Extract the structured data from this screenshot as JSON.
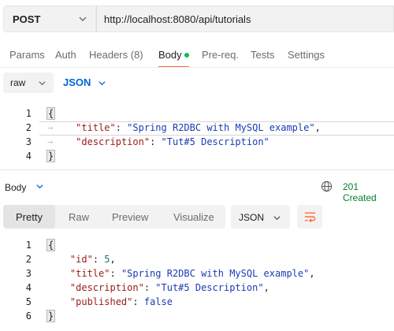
{
  "request": {
    "method": "POST",
    "url": "http://localhost:8080/api/tutorials"
  },
  "request_tabs": [
    {
      "label": "Params",
      "active": false
    },
    {
      "label": "Auth",
      "active": false
    },
    {
      "label": "Headers (8)",
      "active": false
    },
    {
      "label": "Body",
      "active": true
    },
    {
      "label": "Pre-req.",
      "active": false
    },
    {
      "label": "Tests",
      "active": false
    },
    {
      "label": "Settings",
      "active": false
    }
  ],
  "body_mode": {
    "type": "raw",
    "format": "JSON"
  },
  "request_body": {
    "line_numbers": [
      "1",
      "2",
      "3",
      "4"
    ],
    "open_brace": "{",
    "close_brace": "}",
    "fields": [
      {
        "key": "\"title\"",
        "value": "\"Spring R2DBC with MySQL example\"",
        "trail": ","
      },
      {
        "key": "\"description\"",
        "value": "\"Tut#5 Description\"",
        "trail": ""
      }
    ]
  },
  "response": {
    "section_label": "Body",
    "status": "201 Created",
    "status_color": "#007f31",
    "view_tabs": [
      {
        "label": "Pretty",
        "active": true
      },
      {
        "label": "Raw",
        "active": false
      },
      {
        "label": "Preview",
        "active": false
      },
      {
        "label": "Visualize",
        "active": false
      }
    ],
    "format": "JSON",
    "line_numbers": [
      "1",
      "2",
      "3",
      "4",
      "5",
      "6"
    ],
    "open_brace": "{",
    "close_brace": "}",
    "fields": [
      {
        "key": "\"id\"",
        "value": "5",
        "type": "number",
        "trail": ","
      },
      {
        "key": "\"title\"",
        "value": "\"Spring R2DBC with MySQL example\"",
        "type": "string",
        "trail": ","
      },
      {
        "key": "\"description\"",
        "value": "\"Tut#5 Description\"",
        "type": "string",
        "trail": ","
      },
      {
        "key": "\"published\"",
        "value": "false",
        "type": "boolean",
        "trail": ""
      }
    ]
  },
  "icons": {
    "method_dropdown": "chevron-down-icon",
    "globe": "globe-icon",
    "wrap": "wrap-lines-icon"
  },
  "colors": {
    "accent": "#ff6c37",
    "dot": "#0cbb52",
    "link_blue": "#0265d2"
  }
}
